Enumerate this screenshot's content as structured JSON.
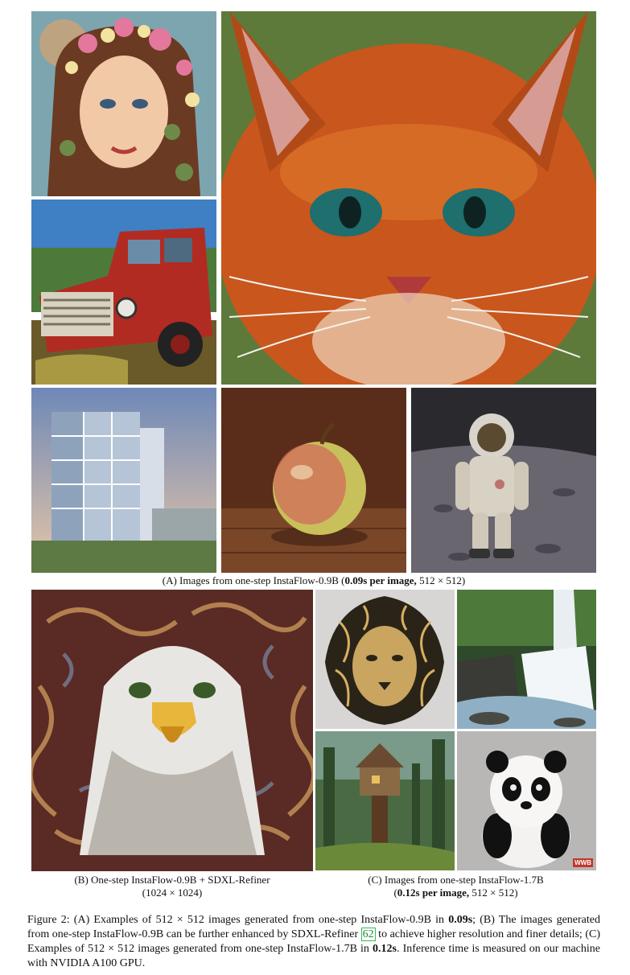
{
  "panel_a": {
    "caption_pre": "(A) Images from one-step InstaFlow-0.9B (",
    "caption_bold": "0.09s per image,",
    "caption_post": " 512 × 512)"
  },
  "panel_b": {
    "caption_line1": "(B) One-step InstaFlow-0.9B + SDXL-Refiner",
    "caption_line2": "(1024 × 1024)"
  },
  "panel_c": {
    "caption_line1": "(C) Images from one-step InstaFlow-1.7B",
    "caption_line2_open": "(",
    "caption_line2_bold": "0.12s per image,",
    "caption_line2_post": " 512 × 512)",
    "watermark": "WWB"
  },
  "figure_caption": {
    "p1": "Figure 2: (A) Examples of 512 × 512 images generated from one-step InstaFlow-0.9B in ",
    "b1": "0.09s",
    "p2": "; (B) The images generated from one-step InstaFlow-0.9B can be further enhanced by SDXL-Refiner ",
    "ref": "62",
    "p3": " to achieve higher resolution and finer details; (C) Examples of 512 × 512 images generated from one-step InstaFlow-1.7B in ",
    "b2": "0.12s",
    "p4": ". Inference time is measured on our machine with NVIDIA A100 GPU."
  }
}
